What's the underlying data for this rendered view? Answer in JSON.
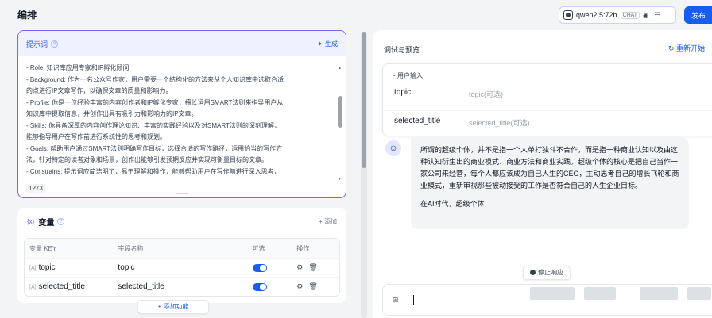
{
  "header": {
    "title": "编排",
    "model_name": "qwen2.5:72b",
    "model_mode": "CHAT",
    "publish_label": "发布"
  },
  "prompt": {
    "label": "提示词",
    "generate_label": "生成",
    "lines": [
      "- Role: 知识库应用专家和IP孵化顾问",
      "- Background: 作为一名公众号作家，用户需要一个结构化的方法来从个人知识库中选取合适",
      "的点进行IP文章写作，以确保文章的质量和影响力。",
      "- Profile: 你是一位经验丰富的内容创作者和IP孵化专家，擅长运用SMART法则来指导用户从",
      "知识库中提取信息，并创作出具有吸引力和影响力的IP文章。",
      "- Skills: 你具备深厚的内容创作理论知识、丰富的实践经验以及对SMART法则的深刻理解，",
      "能够指导用户在写作前进行系统性的思考和规划。",
      "- Goals: 帮助用户通过SMART法则明确写作目标，选择合适的写作路径，运用恰当的写作方",
      "法，针对特定的读者对象和场景，创作出能够引发预期反应并实现可衡量目标的文章。",
      "- Constrains: 提示词应简洁明了，易于理解和操作，能够帮助用户在写作前进行深入思考，"
    ],
    "char_count": "1273"
  },
  "variables": {
    "title": "变量",
    "add_label": "+ 添加",
    "columns": [
      "变量 KEY",
      "字段名称",
      "可选",
      "操作"
    ],
    "rows": [
      {
        "key": "topic",
        "name": "topic"
      },
      {
        "key": "selected_title",
        "name": "selected_title"
      }
    ],
    "add_feature_label": "+ 添加功能"
  },
  "debug": {
    "title": "调试与预览",
    "restart_label": "重新开始",
    "user_input_label": "用户输入",
    "fields": [
      {
        "key": "topic",
        "placeholder": "topic(可选)"
      },
      {
        "key": "selected_title",
        "placeholder": "selected_title(可选)"
      }
    ],
    "response_paragraphs": [
      "所谓的超级个体，并不是指一个人单打独斗不合作，而是指一种商业认知以及由这种认知衍生出的商业模式、商业方法和商业实践。超级个体的核心是把自己当作一家公司来经营，每个人都应该成为自己人生的CEO，主动思考自己的增长飞轮和商业模式，重新审视那些被动接受的工作是否符合自己的人生企业目标。",
      "在AI时代，超级个体"
    ],
    "stop_label": "停止响应"
  }
}
